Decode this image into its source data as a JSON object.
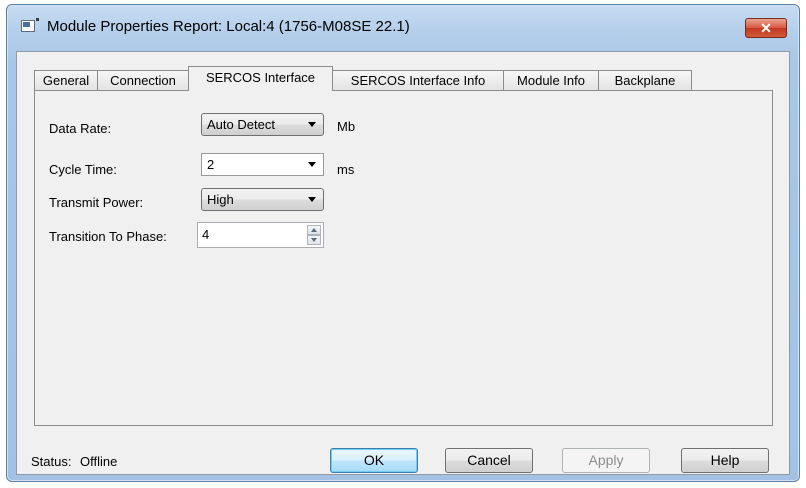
{
  "window": {
    "title": "Module Properties Report: Local:4 (1756-M08SE 22.1)",
    "close_label": "✕"
  },
  "tabs": [
    {
      "label": "General"
    },
    {
      "label": "Connection"
    },
    {
      "label": "SERCOS Interface",
      "active": true
    },
    {
      "label": "SERCOS Interface Info"
    },
    {
      "label": "Module Info"
    },
    {
      "label": "Backplane"
    }
  ],
  "form": {
    "data_rate": {
      "label": "Data Rate:",
      "value": "Auto Detect",
      "unit": "Mb"
    },
    "cycle_time": {
      "label": "Cycle Time:",
      "value": "2",
      "unit": "ms"
    },
    "transmit_power": {
      "label": "Transmit Power:",
      "value": "High"
    },
    "transition_to_phase": {
      "label": "Transition To Phase:",
      "value": "4"
    }
  },
  "footer": {
    "status_label": "Status:",
    "status_value": "Offline",
    "ok_label": "OK",
    "cancel_label": "Cancel",
    "apply_label": "Apply",
    "help_label": "Help"
  }
}
